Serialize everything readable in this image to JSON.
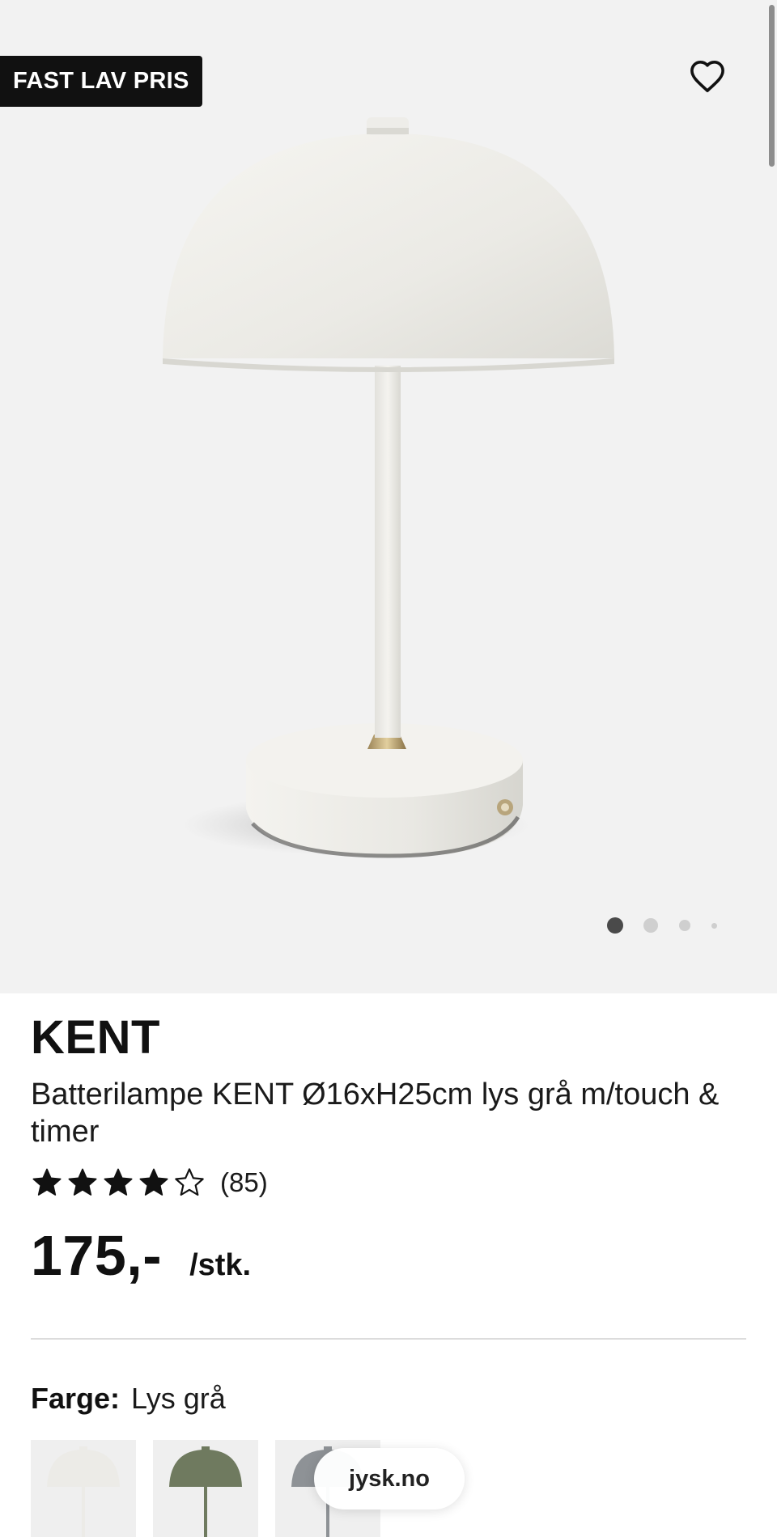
{
  "hero": {
    "badge": "FAST LAV PRIS",
    "favorite_icon": "heart-outline-icon",
    "carousel": {
      "total": 4,
      "active_index": 0
    }
  },
  "product": {
    "brand": "KENT",
    "description": "Batterilampe KENT Ø16xH25cm lys grå m/touch & timer",
    "rating": {
      "value": 4,
      "max": 5,
      "count_text": "(85)"
    },
    "price": "175,-",
    "unit": "/stk."
  },
  "color": {
    "label": "Farge:",
    "value": "Lys grå",
    "swatches": [
      {
        "name": "Lys grå",
        "color": "#ecebe7",
        "selected": true
      },
      {
        "name": "Grønn",
        "color": "#6f7a5f",
        "selected": false
      },
      {
        "name": "Grå",
        "color": "#8e9296",
        "selected": false
      }
    ]
  },
  "browser": {
    "domain": "jysk.no"
  },
  "colors": {
    "hero_bg": "#f2f2f2",
    "badge_bg": "#111111",
    "dot_active": "#4a4a4a",
    "dot_inactive": "#cfcfcf"
  }
}
